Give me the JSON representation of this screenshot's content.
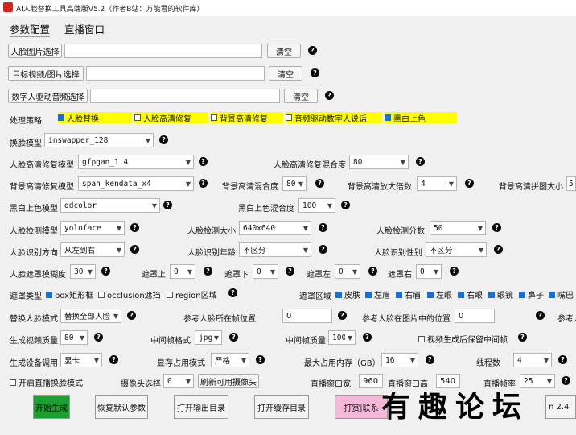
{
  "window": {
    "title": "AI人脸替换工具高端版V5.2（作者B站：万能君的软件库）"
  },
  "tabs": [
    {
      "label": "参数配置"
    },
    {
      "label": "直播窗口"
    }
  ],
  "files": [
    {
      "label": "人脸图片选择",
      "value": "",
      "clear": "清空"
    },
    {
      "label": "目标视频/图片选择",
      "value": "",
      "clear": "清空"
    },
    {
      "label": "数字人驱动音频选择",
      "value": "",
      "clear": "清空"
    }
  ],
  "strategy": {
    "label": "处理策略",
    "options": [
      {
        "label": "人脸替换",
        "checked": true
      },
      {
        "label": "人脸高清修复",
        "checked": false
      },
      {
        "label": "背景高清修复",
        "checked": false
      },
      {
        "label": "音频驱动数字人说话",
        "checked": false
      },
      {
        "label": "黑白上色",
        "checked": true
      }
    ]
  },
  "swap_model": {
    "label": "换脸模型",
    "value": "inswapper_128"
  },
  "face_enhance": {
    "model_label": "人脸高清修复模型",
    "model_value": "gfpgan_1.4",
    "blend_label": "人脸高清修复混合度",
    "blend_value": "80"
  },
  "bg_enhance": {
    "model_label": "背景高清修复模型",
    "model_value": "span_kendata_x4",
    "blend_label": "背景高清混合度",
    "blend_value": "80",
    "scale_label": "背景高清放大倍数",
    "scale_value": "4",
    "tile_label": "背景高清拼图大小",
    "tile_value": "5"
  },
  "colorize": {
    "model_label": "黑白上色模型",
    "model_value": "ddcolor",
    "blend_label": "黑白上色混合度",
    "blend_value": "100"
  },
  "detect": {
    "model_label": "人脸检测模型",
    "model_value": "yoloface",
    "size_label": "人脸检测大小",
    "size_value": "640x640",
    "score_label": "人脸检测分数",
    "score_value": "50"
  },
  "recognize": {
    "dir_label": "人脸识别方向",
    "dir_value": "从左到右",
    "age_label": "人脸识别年龄",
    "age_value": "不区分",
    "gender_label": "人脸识别性别",
    "gender_value": "不区分"
  },
  "mask": {
    "blur_label": "人脸遮罩模糊度",
    "blur_value": "30",
    "top_label": "遮罩上",
    "top_value": "0",
    "bottom_label": "遮罩下",
    "bottom_value": "0",
    "left_label": "遮罩左",
    "left_value": "0",
    "right_label": "遮罩右",
    "right_value": "0"
  },
  "mask_type": {
    "label": "遮罩类型",
    "options": [
      {
        "label": "box矩形框",
        "checked": true
      },
      {
        "label": "occlusion遮挡",
        "checked": false
      },
      {
        "label": "region区域",
        "checked": false
      }
    ]
  },
  "mask_region": {
    "label": "遮罩区域",
    "options": [
      {
        "label": "皮肤",
        "checked": true
      },
      {
        "label": "左眉",
        "checked": true
      },
      {
        "label": "右眉",
        "checked": true
      },
      {
        "label": "左眼",
        "checked": true
      },
      {
        "label": "右眼",
        "checked": true
      },
      {
        "label": "眼镜",
        "checked": true
      },
      {
        "label": "鼻子",
        "checked": true
      },
      {
        "label": "嘴巴",
        "checked": true
      }
    ]
  },
  "replace": {
    "mode_label": "替换人脸模式",
    "mode_value": "替换全部人脸",
    "ref_frame_label": "参考人脸所在帧位置",
    "ref_frame_value": "0",
    "ref_pos_label": "参考人脸在图片中的位置",
    "ref_pos_value": "0",
    "ref_more_label": "参考人"
  },
  "output": {
    "quality_label": "生成视频质量",
    "quality_value": "80",
    "frame_fmt_label": "中间帧格式",
    "frame_fmt_value": "jpg",
    "frame_q_label": "中间帧质量",
    "frame_q_value": "100",
    "keep_frames_label": "视频生成后保留中间帧",
    "keep_frames_checked": false
  },
  "device": {
    "device_label": "生成设备调用",
    "device_value": "显卡",
    "vram_label": "显存占用模式",
    "vram_value": "严格",
    "mem_label": "最大占用内存（GB）",
    "mem_value": "16",
    "threads_label": "线程数",
    "threads_value": "4"
  },
  "live": {
    "enable_label": "开启直播换脸模式",
    "enable_checked": false,
    "cam_label": "摄像头选择",
    "cam_value": "0",
    "refresh_label": "刷新可用摄像头",
    "width_label": "直播窗口宽",
    "width_value": "960",
    "height_label": "直播窗口高",
    "height_value": "540",
    "fps_label": "直播帧率",
    "fps_value": "25"
  },
  "actions": {
    "start": "开始生成",
    "restore": "恢复默认参数",
    "open_output": "打开输出目录",
    "open_cache": "打开缓存目录",
    "donate": "打赏|联系",
    "version": "n 2.4"
  },
  "watermark": "有趣论坛",
  "help_glyph": "?",
  "colors": {
    "start_btn": "#1aa12f",
    "donate_btn": "#f6b8d8",
    "highlight": "#ffff00",
    "check": "#1a6fd6"
  }
}
